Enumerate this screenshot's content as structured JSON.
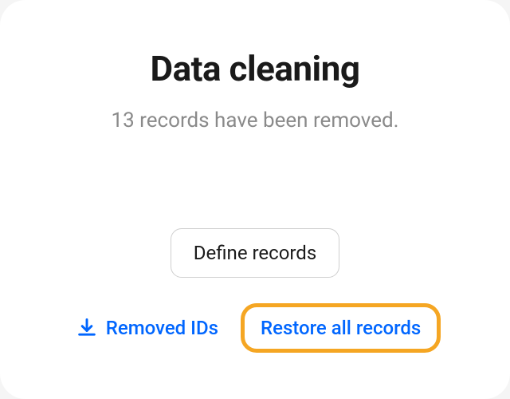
{
  "title": "Data cleaning",
  "subtitle": "13 records have been removed.",
  "buttons": {
    "define": "Define records",
    "removed_ids": "Removed IDs",
    "restore": "Restore all records"
  }
}
